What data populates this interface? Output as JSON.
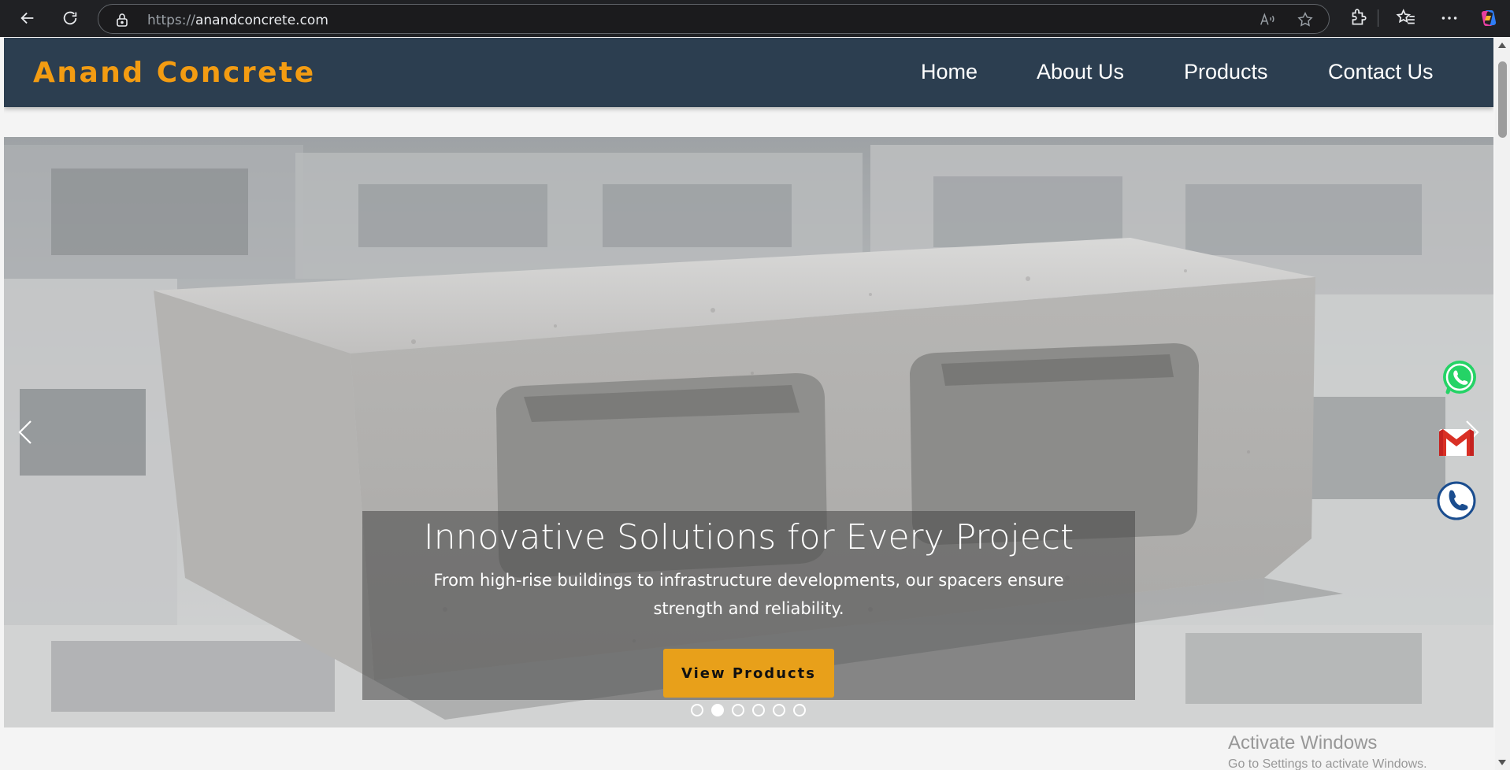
{
  "browser": {
    "url_scheme": "https://",
    "url_host": "anandconcrete.com",
    "icons": [
      "back-icon",
      "reload-icon",
      "lock-icon",
      "read-aloud-icon",
      "favorite-star-icon",
      "extensions-icon",
      "favorites-icon",
      "more-icon",
      "copilot-icon"
    ]
  },
  "site": {
    "logo": "Anand Concrete",
    "nav": {
      "home": "Home",
      "about": "About Us",
      "products": "Products",
      "contact": "Contact Us"
    }
  },
  "hero": {
    "title": "Innovative Solutions for Every Project",
    "text": "From high-rise buildings to infrastructure developments, our spacers ensure strength and reliability.",
    "button": "View Products",
    "slide_count": 6,
    "active_slide": 2
  },
  "floating_contacts": [
    "whatsapp-icon",
    "gmail-icon",
    "phone-icon"
  ],
  "watermark": {
    "title": "Activate Windows",
    "subtitle": "Go to Settings to activate Windows."
  },
  "colors": {
    "header_bg": "#2c3e50",
    "logo": "#f39c12",
    "button": "#e8a01a",
    "browser_bg": "#202124"
  }
}
